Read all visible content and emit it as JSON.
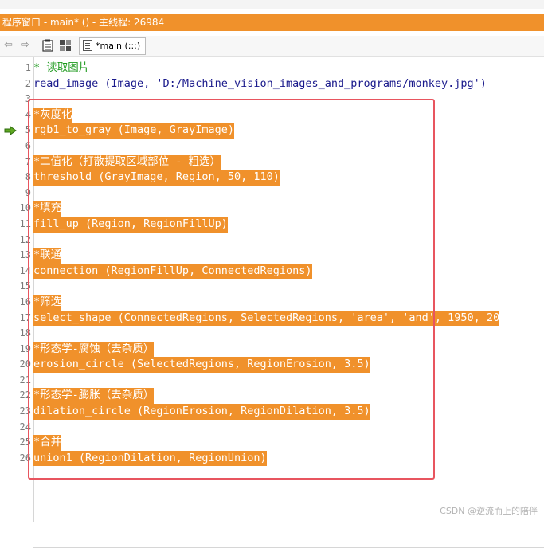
{
  "window": {
    "title": "程序窗口 - main* () - 主线程: 26984"
  },
  "toolbar": {
    "buttons": [
      {
        "name": "back-arrow-icon",
        "glyph": "⇦"
      },
      {
        "name": "forward-arrow-icon",
        "glyph": "⇨"
      }
    ],
    "procedure_tab": "*main (:::)"
  },
  "editor": {
    "current_line": 5,
    "lines": [
      {
        "no": "1",
        "text": "* 读取图片",
        "type": "comment",
        "highlighted": false
      },
      {
        "no": "2",
        "text": "read_image (Image, 'D:/Machine_vision_images_and_programs/monkey.jpg')",
        "type": "code",
        "highlighted": false
      },
      {
        "no": "3",
        "text": "",
        "type": "code",
        "highlighted": false
      },
      {
        "no": "4",
        "text": "*灰度化",
        "type": "comment",
        "highlighted": true
      },
      {
        "no": "5",
        "text": "rgb1_to_gray (Image, GrayImage)",
        "type": "code",
        "highlighted": true
      },
      {
        "no": "6",
        "text": "",
        "type": "code",
        "highlighted": false
      },
      {
        "no": "7",
        "text": "*二值化（打散提取区域部位 - 粗选）",
        "type": "comment",
        "highlighted": true
      },
      {
        "no": "8",
        "text": "threshold (GrayImage, Region, 50, 110)",
        "type": "code",
        "highlighted": true
      },
      {
        "no": "9",
        "text": "",
        "type": "code",
        "highlighted": false
      },
      {
        "no": "10",
        "text": "*填充",
        "type": "comment",
        "highlighted": true
      },
      {
        "no": "11",
        "text": "fill_up (Region, RegionFillUp)",
        "type": "code",
        "highlighted": true
      },
      {
        "no": "12",
        "text": "",
        "type": "code",
        "highlighted": false
      },
      {
        "no": "13",
        "text": "*联通",
        "type": "comment",
        "highlighted": true
      },
      {
        "no": "14",
        "text": "connection (RegionFillUp, ConnectedRegions)",
        "type": "code",
        "highlighted": true
      },
      {
        "no": "15",
        "text": "",
        "type": "code",
        "highlighted": false
      },
      {
        "no": "16",
        "text": "*筛选",
        "type": "comment",
        "highlighted": true
      },
      {
        "no": "17",
        "text": "select_shape (ConnectedRegions, SelectedRegions, 'area', 'and', 1950, 20",
        "type": "code",
        "highlighted": true
      },
      {
        "no": "18",
        "text": "",
        "type": "code",
        "highlighted": false
      },
      {
        "no": "19",
        "text": "*形态学-腐蚀（去杂质）",
        "type": "comment",
        "highlighted": true
      },
      {
        "no": "20",
        "text": "erosion_circle (SelectedRegions, RegionErosion, 3.5)",
        "type": "code",
        "highlighted": true
      },
      {
        "no": "21",
        "text": "",
        "type": "code",
        "highlighted": false
      },
      {
        "no": "22",
        "text": "*形态学-膨胀（去杂质）",
        "type": "comment",
        "highlighted": true
      },
      {
        "no": "23",
        "text": "dilation_circle (RegionErosion, RegionDilation, 3.5)",
        "type": "code",
        "highlighted": true
      },
      {
        "no": "24",
        "text": "",
        "type": "code",
        "highlighted": false
      },
      {
        "no": "25",
        "text": "*合并",
        "type": "comment",
        "highlighted": true
      },
      {
        "no": "26",
        "text": "union1 (RegionDilation, RegionUnion)",
        "type": "code",
        "highlighted": true
      }
    ]
  },
  "watermark": "CSDN @逆流而上的陪伴",
  "colors": {
    "accent": "#f0912b",
    "selection": "#f0912b",
    "comment": "#1f9a1f",
    "code": "#1a1a8c",
    "annotation_box": "#e8555f"
  }
}
